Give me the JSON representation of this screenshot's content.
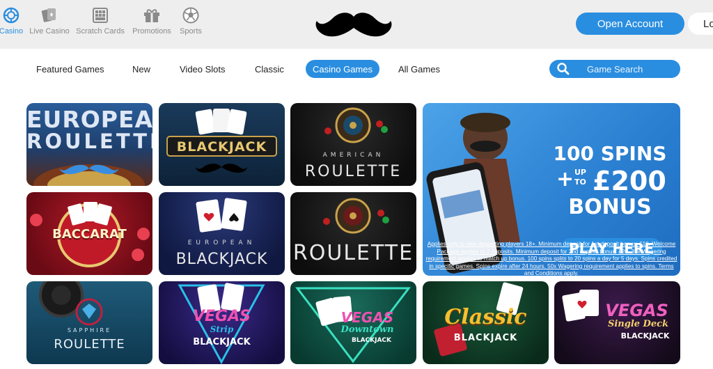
{
  "topnav": [
    {
      "label": "Casino",
      "icon": "roulette-chip-icon",
      "active": true
    },
    {
      "label": "Live Casino",
      "icon": "cards-icon"
    },
    {
      "label": "Scratch Cards",
      "icon": "scratch-card-icon"
    },
    {
      "label": "Promotions",
      "icon": "gift-icon"
    },
    {
      "label": "Sports",
      "icon": "football-icon"
    }
  ],
  "header": {
    "open_account": "Open Account",
    "login": "Lo"
  },
  "categories": [
    "Featured Games",
    "New",
    "Video Slots",
    "Classic",
    "Casino Games",
    "All Games"
  ],
  "active_category": "Casino Games",
  "search": {
    "placeholder": "Game Search"
  },
  "games": [
    {
      "line1": "EUROPEAN",
      "line2": "ROULETTE"
    },
    {
      "line1": "BLACKJACK",
      "line2": ""
    },
    {
      "line1": "AMERICAN",
      "line2": "ROULETTE"
    },
    {
      "line1": "BACCARAT",
      "line2": ""
    },
    {
      "line1": "EUROPEAN",
      "line2": "BLACKJACK"
    },
    {
      "line1": "ROULETTE",
      "line2": ""
    },
    {
      "line1": "SAPPHIRE",
      "line2": "ROULETTE"
    },
    {
      "line1": "VEGAS",
      "line2": "Strip",
      "line3": "BLACKJACK"
    },
    {
      "line1": "VEGAS",
      "line2": "Downtown",
      "line3": "BLACKJACK"
    },
    {
      "line1": "Classic",
      "line2": "BLACKJACK"
    },
    {
      "line1": "VEGAS",
      "line2": "Single Deck",
      "line3": "BLACKJACK"
    }
  ],
  "promo": {
    "line1": "100 SPINS",
    "line2a": "+",
    "line2b": "UP",
    "line2c": "TO",
    "line2d": "£200",
    "line3": "BONUS",
    "cta": "PLAY HERE",
    "terms": "Applies only to new depositing players 18+. Minimum deposit for 1st deposit bonus: £10. Welcome Package applies to 2 deposits. Minimum deposit for 2nd deposit bonus: £20. 35x Wagering requirement applies to match up bonus. 100 spins splits to 20 spins a day for 5 days. Spins credited in specific games. Spins expire after 24 hours. 50x Wagering requirement applies to spins. Terms and Conditions apply."
  },
  "colors": {
    "accent": "#2a8ee0",
    "topbar": "#eeeeee"
  }
}
